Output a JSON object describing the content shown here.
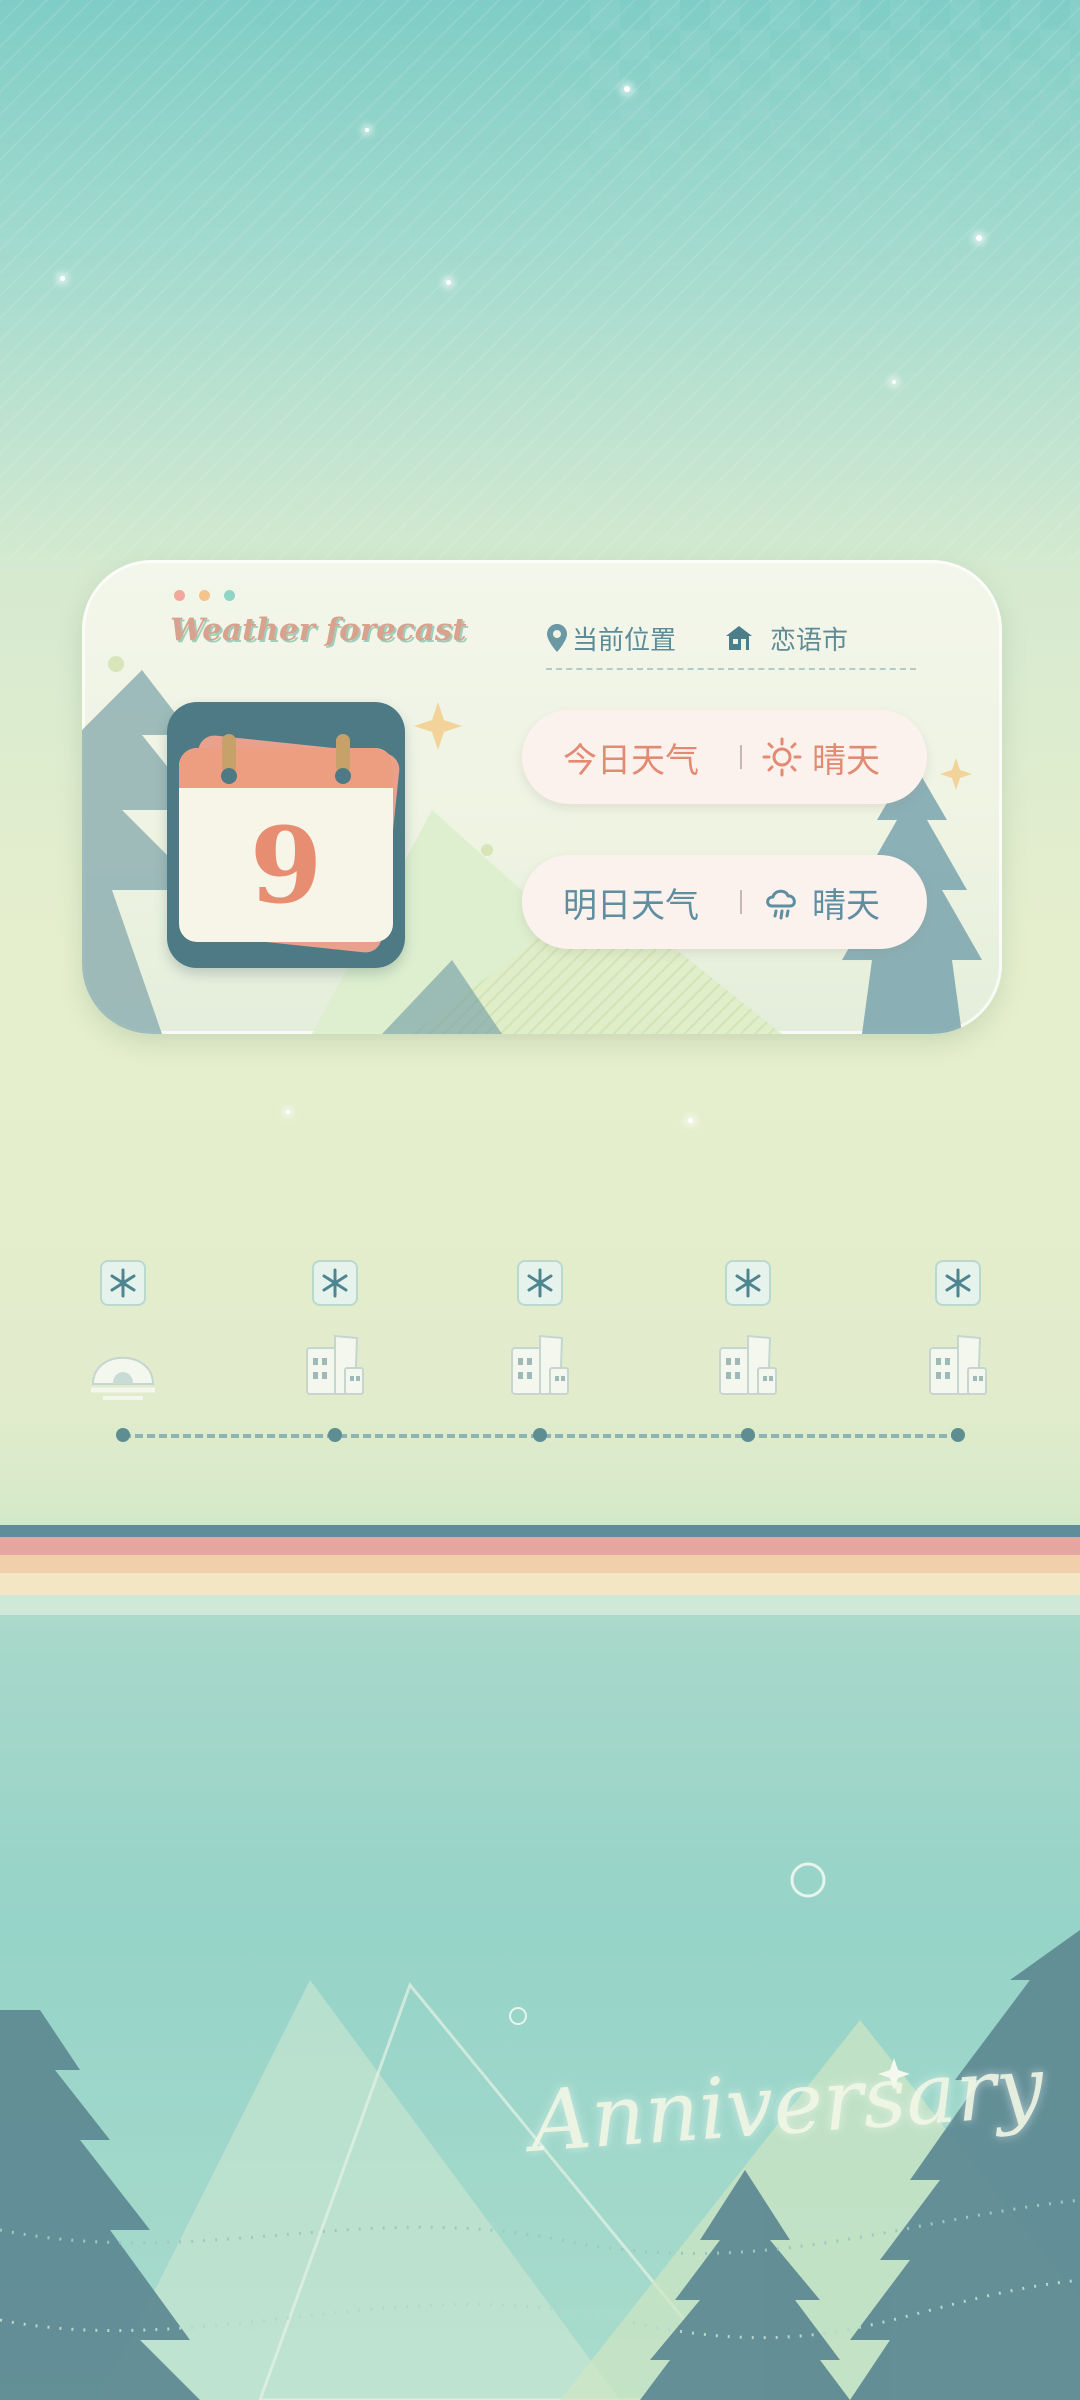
{
  "widget": {
    "title_script": "Weather forecast",
    "location_label": "当前位置",
    "city": "恋语市",
    "calendar_day": "9",
    "today": {
      "label": "今日天气",
      "condition": "晴天",
      "icon": "sun-icon"
    },
    "tomorrow": {
      "label": "明日天气",
      "condition": "晴天",
      "icon": "cloud-rain-icon"
    }
  },
  "timeline": {
    "items": [
      {
        "icon": "snowflake-icon",
        "place_icon": "igloo-icon"
      },
      {
        "icon": "snowflake-icon",
        "place_icon": "buildings-icon"
      },
      {
        "icon": "snowflake-icon",
        "place_icon": "buildings-icon"
      },
      {
        "icon": "snowflake-icon",
        "place_icon": "buildings-icon"
      },
      {
        "icon": "snowflake-icon",
        "place_icon": "buildings-icon"
      }
    ]
  },
  "decoration": {
    "script_text": "Anniversary"
  },
  "colors": {
    "accent_orange": "#e38a72",
    "accent_teal": "#5e8ea0",
    "card_bg": "#f3f6ea"
  }
}
